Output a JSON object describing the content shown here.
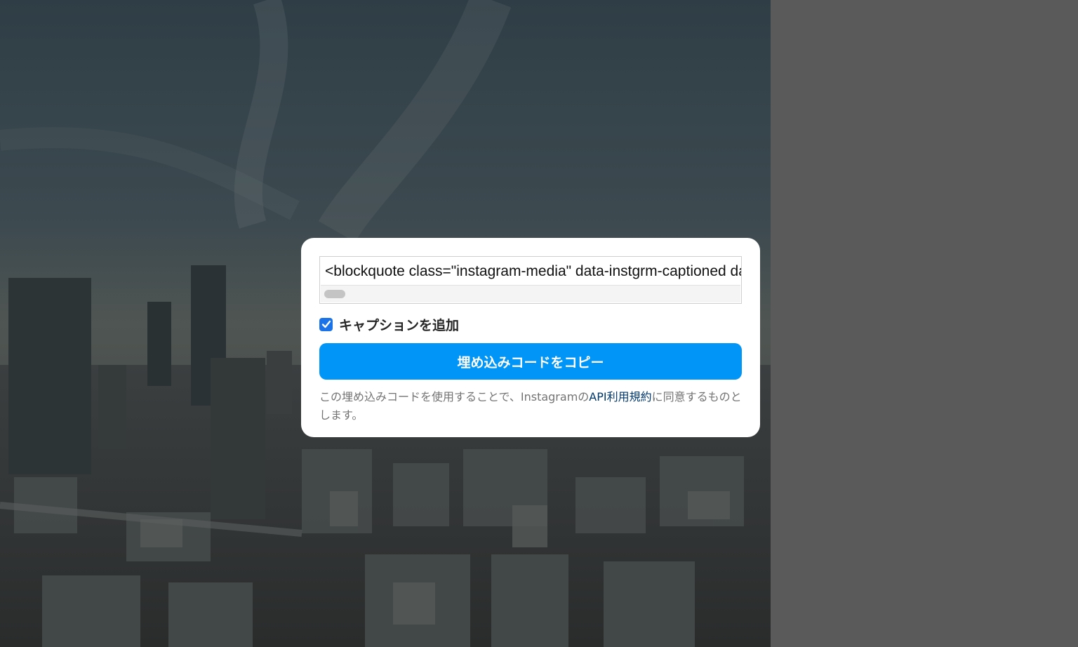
{
  "embed_dialog": {
    "code_snippet": "<blockquote class=\"instagram-media\" data-instgrm-captioned data-instgrm-permalink=\"https://www.instagram.com/p/",
    "caption_checkbox": {
      "label": "キャプションを追加",
      "checked": true
    },
    "copy_button_label": "埋め込みコードをコピー",
    "notice": {
      "prefix": "この埋め込みコードを使用することで、Instagramの",
      "link_text": "API利用規約",
      "suffix": "に同意するものとします。"
    }
  },
  "colors": {
    "button": "#0095f6",
    "checkbox": "#1a73e8",
    "link": "#00376b",
    "overlay": "#5a5a5a"
  },
  "icons": {
    "checkbox": "checkmark-icon"
  }
}
